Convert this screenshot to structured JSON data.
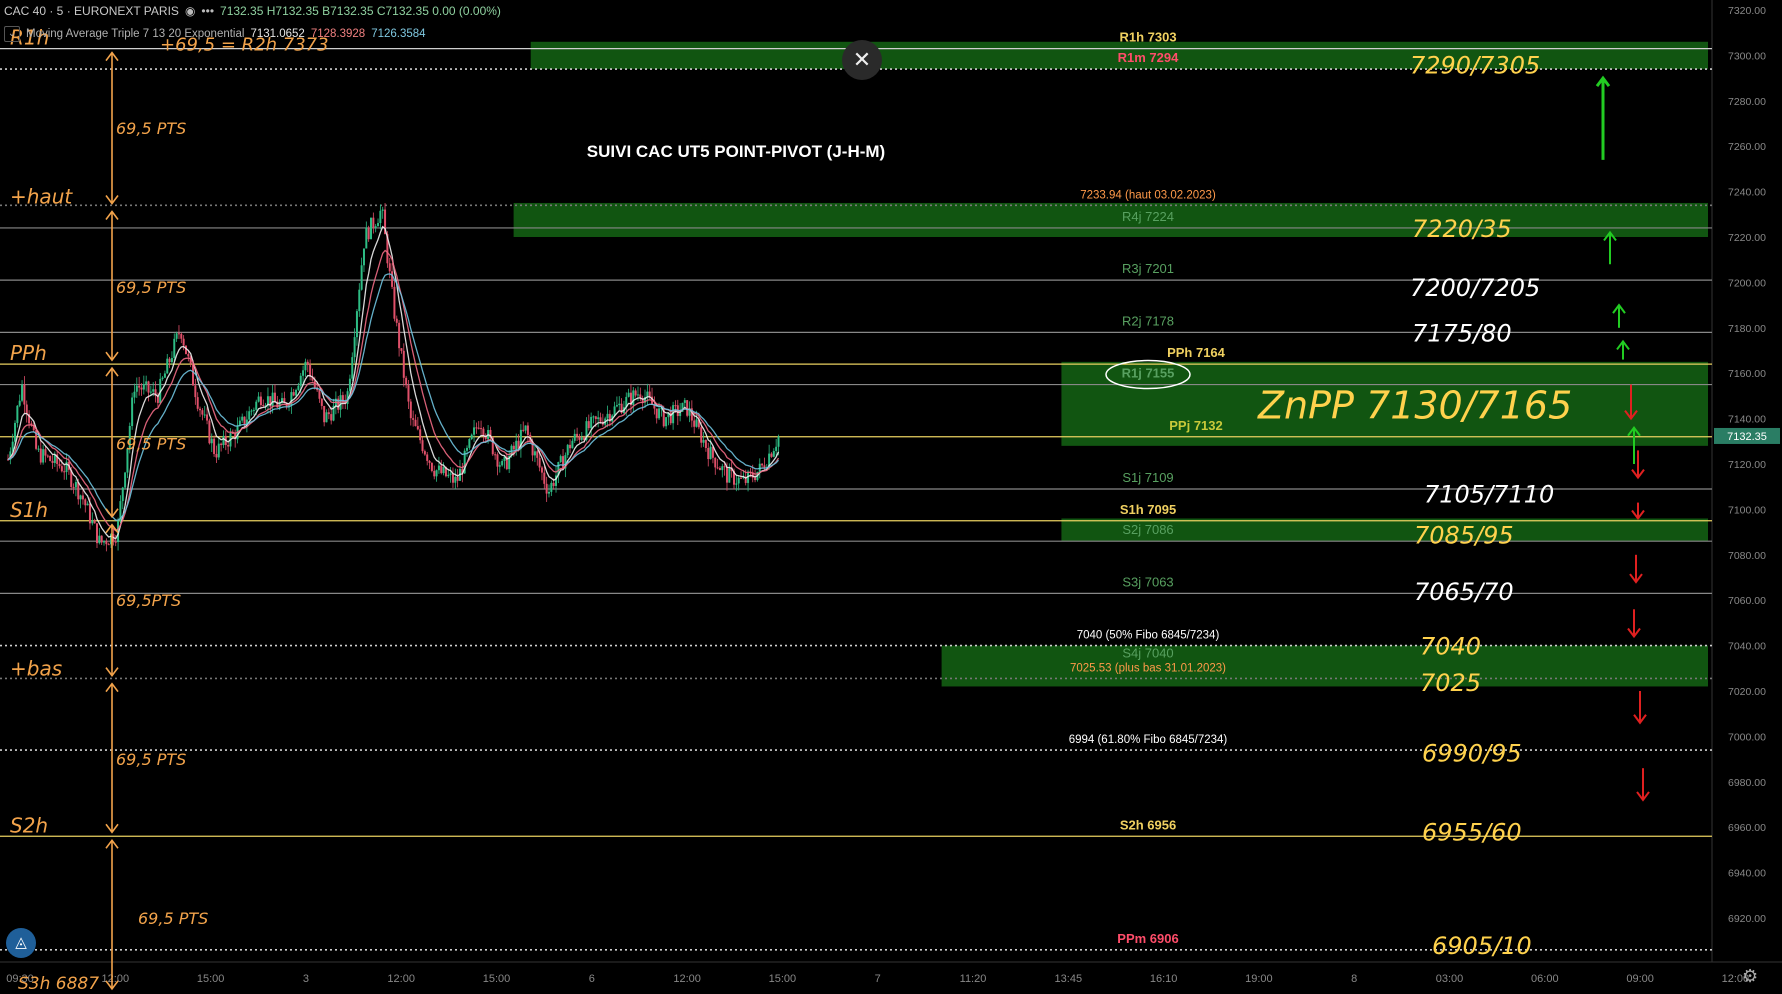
{
  "header": {
    "symbol": "CAC 40 · 5 · EURONEXT PARIS",
    "ohlc": "7132.35  H7132.35  B7132.35  C7132.35  0.00 (0.00%)",
    "indicator_name": "Moving Average Triple 7 13 20 Exponential",
    "indicator_values": [
      "7131.0652",
      "7128.3928",
      "7126.3584"
    ]
  },
  "title": "SUIVI CAC UT5 POINT-PIVOT (J-H-M)",
  "colors": {
    "background": "#000000",
    "up_candle": "#2ebd85",
    "down_candle": "#e0506a",
    "ma_fast": "#f0f0f0",
    "ma_mid": "#f06a84",
    "ma_slow": "#6fc3df",
    "price_tag": "#2a7d64",
    "zone": "#1f9a1f",
    "handwriting": "#ffd24d",
    "hand_orange": "#f2a34b",
    "arrow_up": "#22cc22",
    "arrow_down": "#e02020"
  },
  "chart_data": {
    "type": "candlestick",
    "ylim": [
      6900,
      7322
    ],
    "last_price": "7132.35",
    "y_ticks": [
      "7320.00",
      "7300.00",
      "7280.00",
      "7260.00",
      "7240.00",
      "7220.00",
      "7200.00",
      "7180.00",
      "7160.00",
      "7140.00",
      "7120.00",
      "7100.00",
      "7080.00",
      "7060.00",
      "7040.00",
      "7020.00",
      "7000.00",
      "6980.00",
      "6960.00",
      "6940.00",
      "6920.00"
    ],
    "x_ticks": [
      "09:30",
      "12:00",
      "15:00",
      "3",
      "12:00",
      "15:00",
      "6",
      "12:00",
      "15:00",
      "7",
      "11:20",
      "13:45",
      "16:10",
      "19:00",
      "8",
      "03:00",
      "06:00",
      "09:00",
      "12:00"
    ],
    "pivot_levels": [
      {
        "label": "R1h 7303",
        "value": 7303,
        "style": "solid",
        "color": "#cfcfcf",
        "text_color": "#f0d060"
      },
      {
        "label": "R1m 7294",
        "value": 7294,
        "style": "dotted",
        "color": "#cfcfcf",
        "text_color": "#ff4d6a"
      },
      {
        "label": "7233.94 (haut 03.02.2023)",
        "value": 7233.94,
        "style": "dotted",
        "color": "#777777",
        "text_color": "#ff9a4a"
      },
      {
        "label": "R4j 7224",
        "value": 7224,
        "style": "solid",
        "color": "#888888",
        "text_color": "#58a060"
      },
      {
        "label": "R3j 7201",
        "value": 7201,
        "style": "solid",
        "color": "#888888",
        "text_color": "#58a060"
      },
      {
        "label": "R2j 7178",
        "value": 7178,
        "style": "solid",
        "color": "#888888",
        "text_color": "#58a060"
      },
      {
        "label": "PPh 7164",
        "value": 7164,
        "style": "solid",
        "color": "#e8d060",
        "text_color": "#f0d060"
      },
      {
        "label": "R1j 7155",
        "value": 7155,
        "style": "solid",
        "color": "#888888",
        "text_color": "#58a060"
      },
      {
        "label": "PPj 7132",
        "value": 7132,
        "style": "solid",
        "color": "#e8d060",
        "text_color": "#c9c93a"
      },
      {
        "label": "S1j 7109",
        "value": 7109,
        "style": "solid",
        "color": "#888888",
        "text_color": "#58a060"
      },
      {
        "label": "S1h 7095",
        "value": 7095,
        "style": "solid",
        "color": "#e8d060",
        "text_color": "#f0d060"
      },
      {
        "label": "S2j 7086",
        "value": 7086,
        "style": "solid",
        "color": "#888888",
        "text_color": "#58a060"
      },
      {
        "label": "S3j 7063",
        "value": 7063,
        "style": "solid",
        "color": "#888888",
        "text_color": "#58a060"
      },
      {
        "label": "7040 (50% Fibo 6845/7234)",
        "value": 7040,
        "style": "dotted",
        "color": "#cfcfcf",
        "text_color": "#ffffff"
      },
      {
        "label": "S4j 7040",
        "value": 7040,
        "style": "none",
        "color": "#888888",
        "text_color": "#58a060"
      },
      {
        "label": "7025.53 (plus bas 31.01.2023)",
        "value": 7025.53,
        "style": "dotted",
        "color": "#777777",
        "text_color": "#ff9a4a"
      },
      {
        "label": "6994 (61.80% Fibo 6845/7234)",
        "value": 6994,
        "style": "dotted",
        "color": "#cfcfcf",
        "text_color": "#ffffff"
      },
      {
        "label": "S2h 6956",
        "value": 6956,
        "style": "solid",
        "color": "#e8d060",
        "text_color": "#f0d060"
      },
      {
        "label": "PPm 6906",
        "value": 6906,
        "style": "dotted",
        "color": "#cfcfcf",
        "text_color": "#ff4d6a"
      }
    ],
    "zones": [
      {
        "from": 7294,
        "to": 7306,
        "start": 0.31
      },
      {
        "from": 7220,
        "to": 7235,
        "start": 0.3
      },
      {
        "from": 7128,
        "to": 7165,
        "start": 0.62
      },
      {
        "from": 7086,
        "to": 7096,
        "start": 0.62
      },
      {
        "from": 7022,
        "to": 7040,
        "start": 0.55
      }
    ],
    "price_path": [
      [
        0,
        7122
      ],
      [
        0.012,
        7155
      ],
      [
        0.025,
        7125
      ],
      [
        0.05,
        7118
      ],
      [
        0.065,
        7105
      ],
      [
        0.08,
        7085
      ],
      [
        0.095,
        7090
      ],
      [
        0.11,
        7155
      ],
      [
        0.13,
        7150
      ],
      [
        0.15,
        7180
      ],
      [
        0.165,
        7148
      ],
      [
        0.18,
        7125
      ],
      [
        0.2,
        7135
      ],
      [
        0.22,
        7150
      ],
      [
        0.24,
        7145
      ],
      [
        0.26,
        7165
      ],
      [
        0.275,
        7140
      ],
      [
        0.295,
        7150
      ],
      [
        0.31,
        7220
      ],
      [
        0.325,
        7232
      ],
      [
        0.335,
        7190
      ],
      [
        0.35,
        7140
      ],
      [
        0.37,
        7118
      ],
      [
        0.39,
        7112
      ],
      [
        0.41,
        7140
      ],
      [
        0.43,
        7118
      ],
      [
        0.45,
        7135
      ],
      [
        0.47,
        7108
      ],
      [
        0.49,
        7130
      ],
      [
        0.51,
        7138
      ],
      [
        0.53,
        7145
      ],
      [
        0.55,
        7152
      ],
      [
        0.57,
        7140
      ],
      [
        0.59,
        7145
      ],
      [
        0.61,
        7125
      ],
      [
        0.625,
        7115
      ],
      [
        0.64,
        7112
      ],
      [
        0.655,
        7118
      ],
      [
        0.67,
        7132
      ]
    ],
    "ma_offsets": [
      0,
      5,
      9
    ]
  },
  "annotations": {
    "left_labels": [
      "R1h",
      "+haut",
      "PPh",
      "S1h",
      "+bas",
      "S2h",
      "S3h 6887"
    ],
    "left_note_top": "+69,5 = R2h 7373",
    "left_gaps": [
      "69,5 PTS",
      "69,5 PTS",
      "69,5 PTS",
      "69,5PTS",
      "69,5 PTS",
      "69,5 PTS"
    ],
    "right_targets": [
      "7290/7305",
      "7220/35",
      "7200/7205",
      "7175/80",
      "ZnPP  7130/7165",
      "7105/7110",
      "7085/95",
      "7065/70",
      "7040",
      "7025",
      "6990/95",
      "6955/60",
      "6905/10"
    ]
  }
}
